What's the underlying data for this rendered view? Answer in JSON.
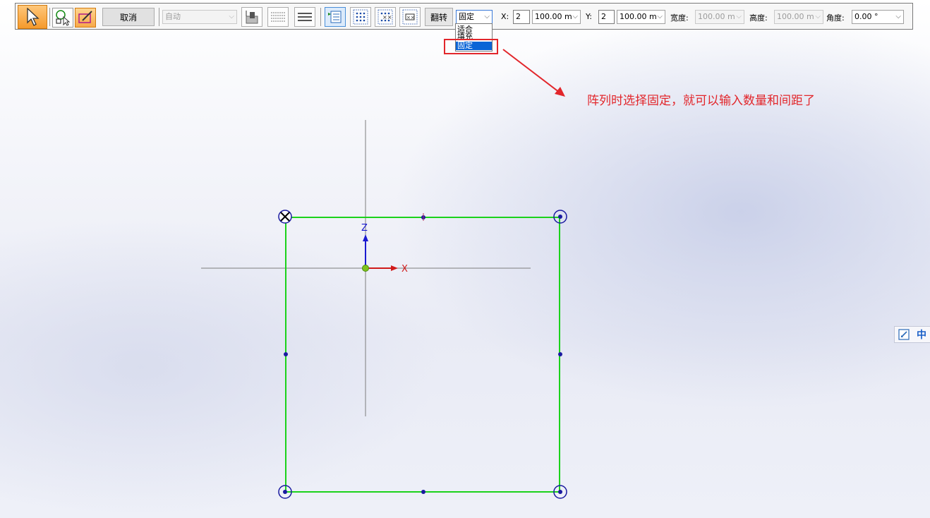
{
  "toolbar": {
    "cancel_label": "取消",
    "mode_select": "自动",
    "flip_label": "翻转",
    "fit_mode_select": "固定",
    "fit_mode_options": [
      "适合",
      "填充",
      "固定"
    ],
    "x_label": "X:",
    "x_count": "2",
    "x_spacing": "100.00 m",
    "y_label": "Y:",
    "y_count": "2",
    "y_spacing": "100.00 m",
    "width_label": "宽度:",
    "width_value": "100.00 m",
    "height_label": "高度:",
    "height_value": "100.00 m",
    "angle_label": "角度:",
    "angle_value": "0.00 °"
  },
  "annotation": {
    "text": "阵列时选择固定，就可以输入数量和间距了",
    "color": "#e2262b"
  },
  "canvas": {
    "axis_z_label": "Z",
    "axis_x_label": "X",
    "sketch_line_color": "#1bd21b",
    "axis_line_color": "#777777"
  },
  "side_panel": {
    "ime_label": "中"
  }
}
